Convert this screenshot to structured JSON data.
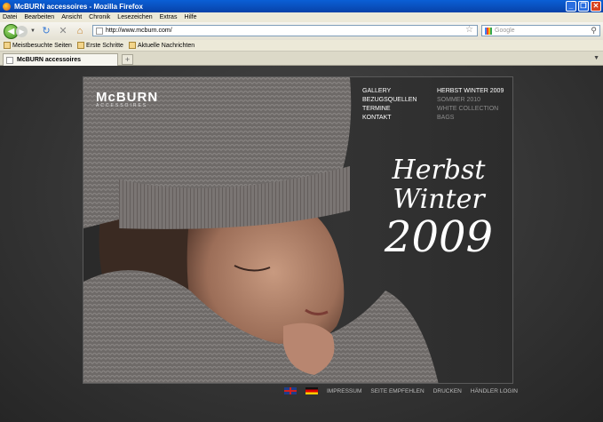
{
  "window": {
    "title": "McBURN accessoires - Mozilla Firefox"
  },
  "menubar": [
    "Datei",
    "Bearbeiten",
    "Ansicht",
    "Chronik",
    "Lesezeichen",
    "Extras",
    "Hilfe"
  ],
  "navbar": {
    "url": "http://www.mcburn.com/",
    "search_placeholder": "Google"
  },
  "bookmarks": [
    "Meistbesuchte Seiten",
    "Erste Schritte",
    "Aktuelle Nachrichten"
  ],
  "tabs": [
    {
      "label": "McBURN accessoires"
    }
  ],
  "site": {
    "logo": {
      "name": "McBURN",
      "sub": "ACCESSOIRES"
    },
    "menu_primary": [
      "GALLERY",
      "BEZUGSQUELLEN",
      "TERMINE",
      "KONTAKT"
    ],
    "menu_collections": [
      "HERBST WINTER 2009",
      "SOMMER 2010",
      "WHITE COLLECTION",
      "BAGS"
    ],
    "headline": {
      "line1": "Herbst",
      "line2": "Winter",
      "line3": "2009"
    },
    "footer": [
      "IMPRESSUM",
      "SEITE EMPFEHLEN",
      "DRUCKEN",
      "HÄNDLER LOGIN"
    ]
  },
  "colors": {
    "titlebar": "#0a5fd6",
    "page_bg": "#3a3a3a",
    "panel_bg": "#313131"
  }
}
